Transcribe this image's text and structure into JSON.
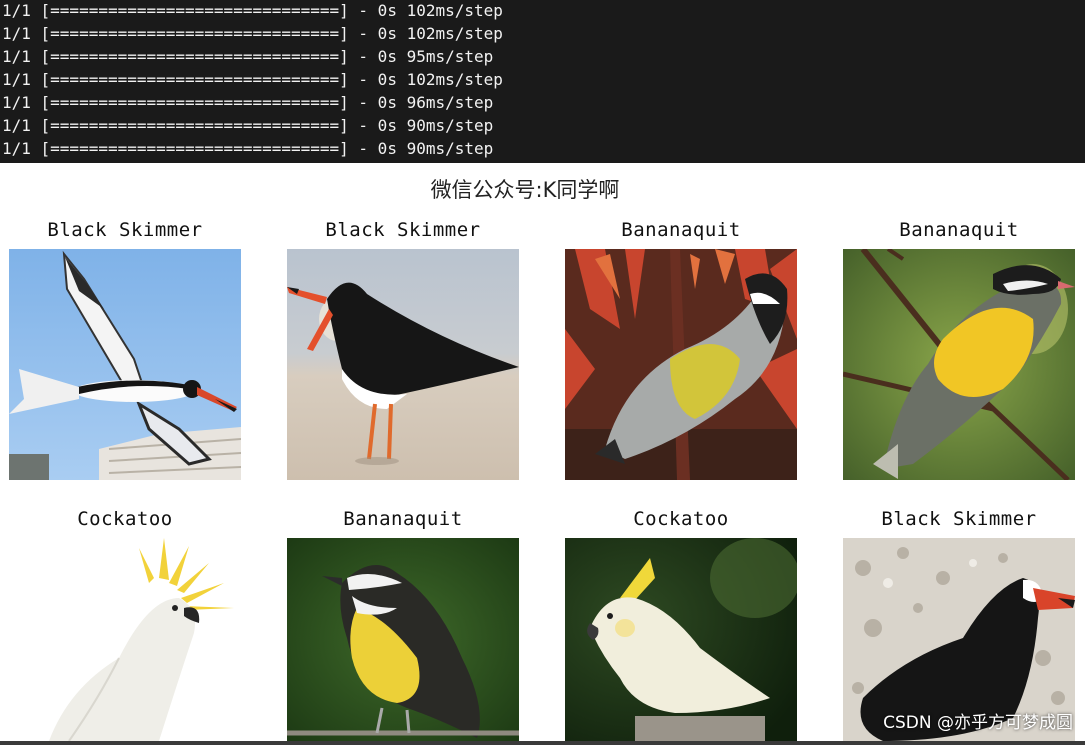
{
  "terminal": {
    "lines": [
      "1/1 [==============================] - 0s 102ms/step",
      "1/1 [==============================] - 0s 102ms/step",
      "1/1 [==============================] - 0s 95ms/step",
      "1/1 [==============================] - 0s 102ms/step",
      "1/1 [==============================] - 0s 96ms/step",
      "1/1 [==============================] - 0s 90ms/step",
      "1/1 [==============================] - 0s 90ms/step"
    ]
  },
  "figure": {
    "suptitle": "微信公众号:K同学啊",
    "cells": [
      {
        "label": "Black Skimmer"
      },
      {
        "label": "Black Skimmer"
      },
      {
        "label": "Bananaquit"
      },
      {
        "label": "Bananaquit"
      },
      {
        "label": "Cockatoo"
      },
      {
        "label": "Bananaquit"
      },
      {
        "label": "Cockatoo"
      },
      {
        "label": "Black Skimmer"
      }
    ]
  },
  "watermark": "CSDN @亦乎方可梦成圆",
  "colors": {
    "terminal_bg": "#1a1a1a",
    "terminal_text": "#f2f2f2"
  }
}
